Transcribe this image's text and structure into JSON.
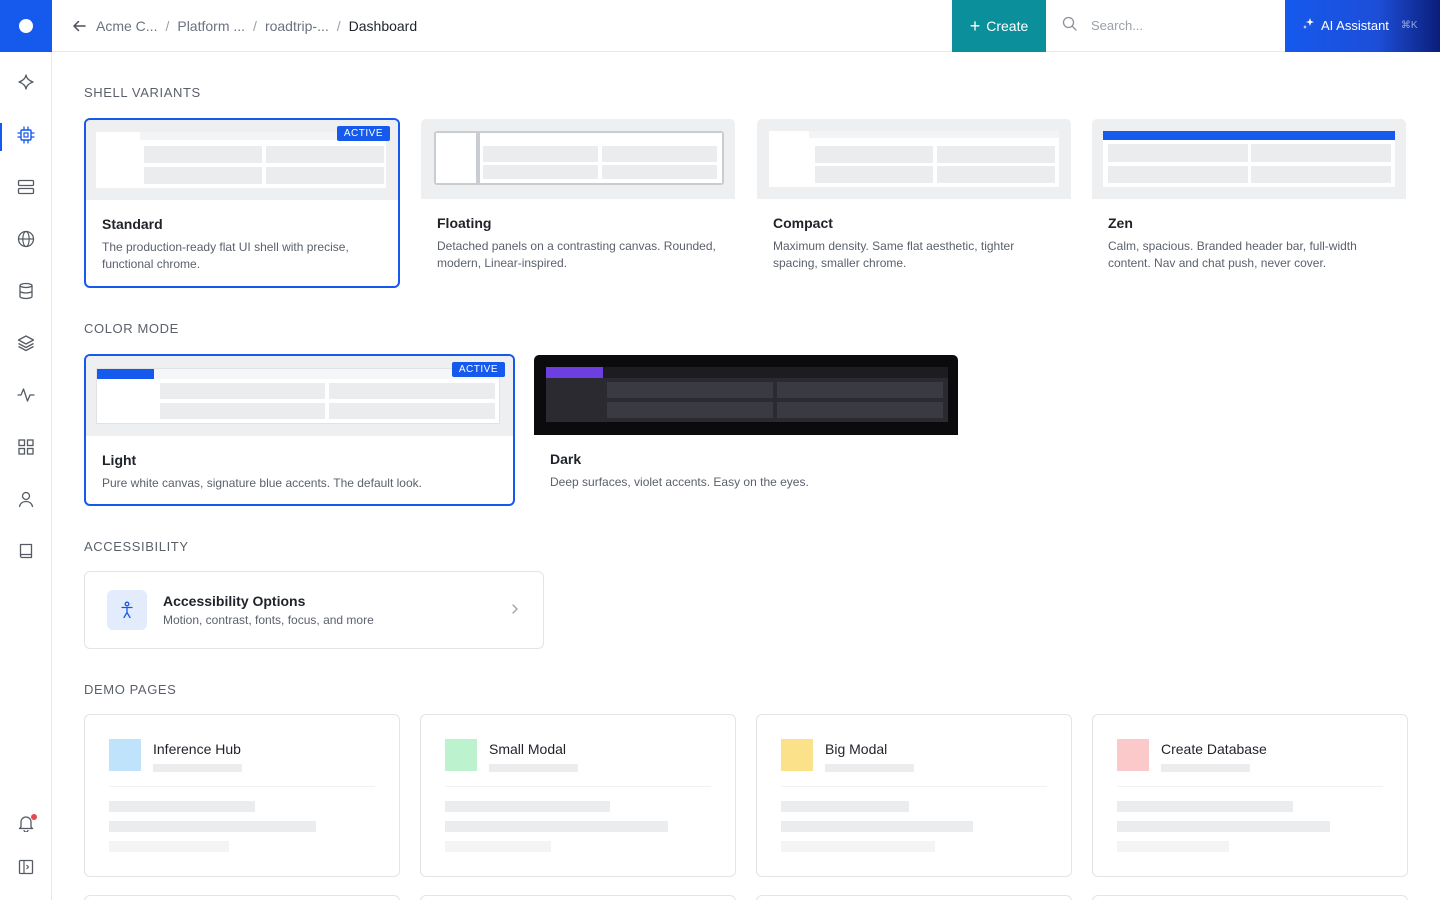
{
  "header": {
    "breadcrumbs": [
      "Acme C...",
      "Platform ...",
      "roadtrip-...",
      "Dashboard"
    ],
    "create_label": "Create",
    "search_placeholder": "Search...",
    "ai_label": "AI Assistant",
    "ai_shortcut": "⌘K"
  },
  "sidebar": {
    "items": [
      {
        "icon": "sparkle-icon"
      },
      {
        "icon": "chip-icon",
        "active": true
      },
      {
        "icon": "server-icon"
      },
      {
        "icon": "globe-icon"
      },
      {
        "icon": "database-icon"
      },
      {
        "icon": "layers-icon"
      },
      {
        "icon": "activity-icon"
      },
      {
        "icon": "grid-icon"
      },
      {
        "icon": "user-icon"
      },
      {
        "icon": "book-icon"
      }
    ],
    "bottom": [
      {
        "icon": "bell-icon",
        "has_notification": true
      },
      {
        "icon": "sidebar-toggle-icon"
      }
    ]
  },
  "sections": {
    "shell": "SHELL VARIANTS",
    "color": "COLOR MODE",
    "a11y": "ACCESSIBILITY",
    "demo": "DEMO PAGES"
  },
  "shell_variants": [
    {
      "title": "Standard",
      "desc": "The production-ready flat UI shell with precise, functional chrome.",
      "active": true,
      "badge": "ACTIVE"
    },
    {
      "title": "Floating",
      "desc": "Detached panels on a contrasting canvas. Rounded, modern, Linear-inspired."
    },
    {
      "title": "Compact",
      "desc": "Maximum density. Same flat aesthetic, tighter spacing, smaller chrome."
    },
    {
      "title": "Zen",
      "desc": "Calm, spacious. Branded header bar, full-width content. Nav and chat push, never cover."
    }
  ],
  "color_modes": [
    {
      "title": "Light",
      "desc": "Pure white canvas, signature blue accents. The default look.",
      "active": true,
      "badge": "ACTIVE"
    },
    {
      "title": "Dark",
      "desc": "Deep surfaces, violet accents. Easy on the eyes."
    }
  ],
  "accessibility": {
    "title": "Accessibility Options",
    "desc": "Motion, contrast, fonts, focus, and more"
  },
  "demo_pages": [
    {
      "title": "Inference Hub",
      "swatch": "#bfe3fb"
    },
    {
      "title": "Small Modal",
      "swatch": "#bdf2cf"
    },
    {
      "title": "Big Modal",
      "swatch": "#fbe28a"
    },
    {
      "title": "Create Database",
      "swatch": "#fbc9c9"
    }
  ],
  "colors": {
    "brand": "#1559ed",
    "create": "#0a8f9b",
    "dark_accent": "#6d3fe0"
  }
}
